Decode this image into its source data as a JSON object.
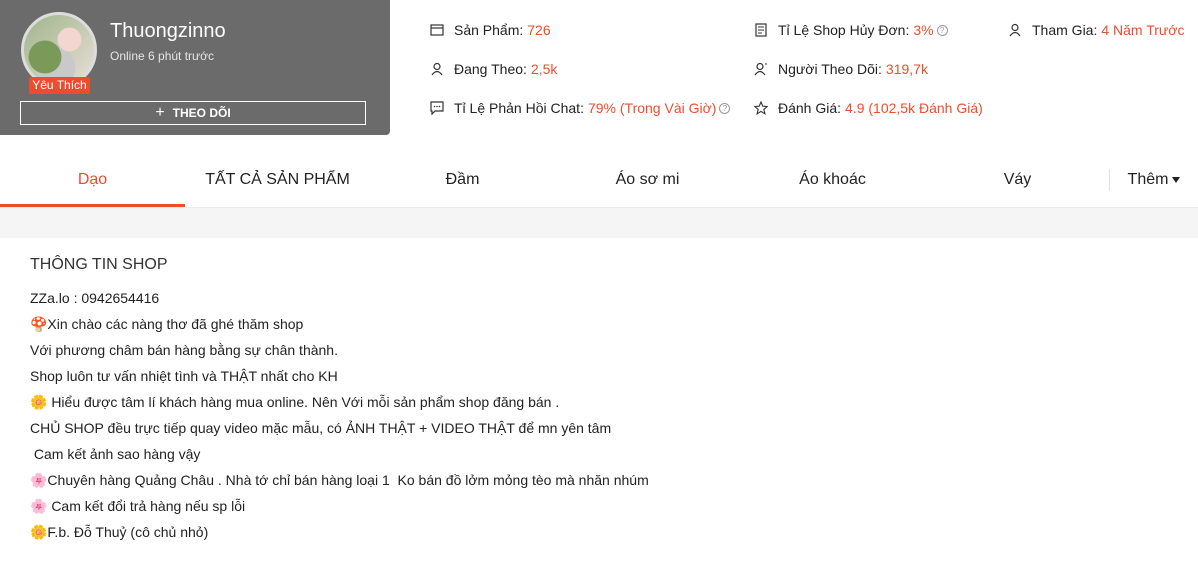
{
  "shop": {
    "name": "Thuongzinno",
    "online_status": "Online 6 phút trước",
    "badge": "Yêu Thích",
    "follow_label": "THEO DÕI"
  },
  "stats": {
    "products_label": "Sản Phẩm:",
    "products_value": "726",
    "following_label": "Đang Theo:",
    "following_value": "2,5k",
    "chat_label": "Tỉ Lệ Phản Hồi Chat:",
    "chat_value": "79% (Trong Vài Giờ)",
    "cancel_label": "Tỉ Lệ Shop Hủy Đơn:",
    "cancel_value": "3%",
    "followers_label": "Người Theo Dõi:",
    "followers_value": "319,7k",
    "rating_label": "Đánh Giá:",
    "rating_value": "4.9 (102,5k Đánh Giá)",
    "joined_label": "Tham Gia:",
    "joined_value": "4 Năm Trước"
  },
  "tabs": [
    "Dạo",
    "TẤT CẢ SẢN PHẨM",
    "Đầm",
    "Áo sơ mi",
    "Áo khoác",
    "Váy"
  ],
  "more_label": "Thêm",
  "info": {
    "title": "THÔNG TIN SHOP",
    "lines": [
      "ZZa.lo : 0942654416",
      "🍄Xin chào các nàng thơ đã ghé thăm shop",
      "Với phương châm bán hàng bằng sự chân thành.",
      "Shop luôn tư vấn nhiệt tình và THẬT nhất cho KH",
      "🌼 Hiểu được tâm lí khách hàng mua online. Nên Với mỗi sản phẩm shop đăng bán .",
      "CHỦ SHOP đều trực tiếp quay video mặc mẫu, có ẢNH THẬT + VIDEO THẬT để mn yên tâm",
      " Cam kết ảnh sao hàng vậy",
      "🌸Chuyên hàng Quảng Châu . Nhà tớ chỉ bán hàng loại 1  Ko bán đồ lởm mỏng tèo mà nhăn nhúm",
      "🌸 Cam kết đổi trả hàng nếu sp lỗi",
      "🌼F.b. Đỗ Thuỷ (cô chủ nhỏ)"
    ]
  },
  "colors": {
    "accent": "#ee4d2d",
    "card_bg": "#6b6b6b"
  }
}
